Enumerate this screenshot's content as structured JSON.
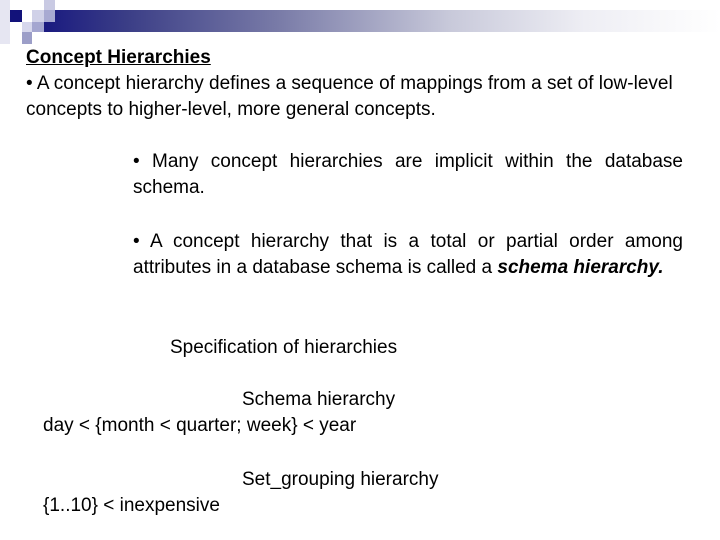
{
  "slide": {
    "title": "Concept Hierarchies",
    "intro": "• A concept hierarchy defines a sequence of mappings from a set of low-level concepts to higher-level, more general concepts.",
    "bullets": [
      {
        "text": "• Many concept hierarchies are implicit within the database schema."
      },
      {
        "text": "• A concept hierarchy that is a total or partial order among attributes in a database schema is called a ",
        "emphasis": "schema hierarchy."
      }
    ],
    "specification_heading": "Specification of hierarchies",
    "examples": [
      {
        "label": "Schema hierarchy",
        "expression": "day < {month < quarter; week} < year"
      },
      {
        "label": "Set_grouping hierarchy",
        "expression": "{1..10} < inexpensive"
      }
    ]
  },
  "theme": {
    "accent_dark": "#1a1a80",
    "accent_medium": "#9a9cc8",
    "accent_light": "#d4d5ea"
  }
}
